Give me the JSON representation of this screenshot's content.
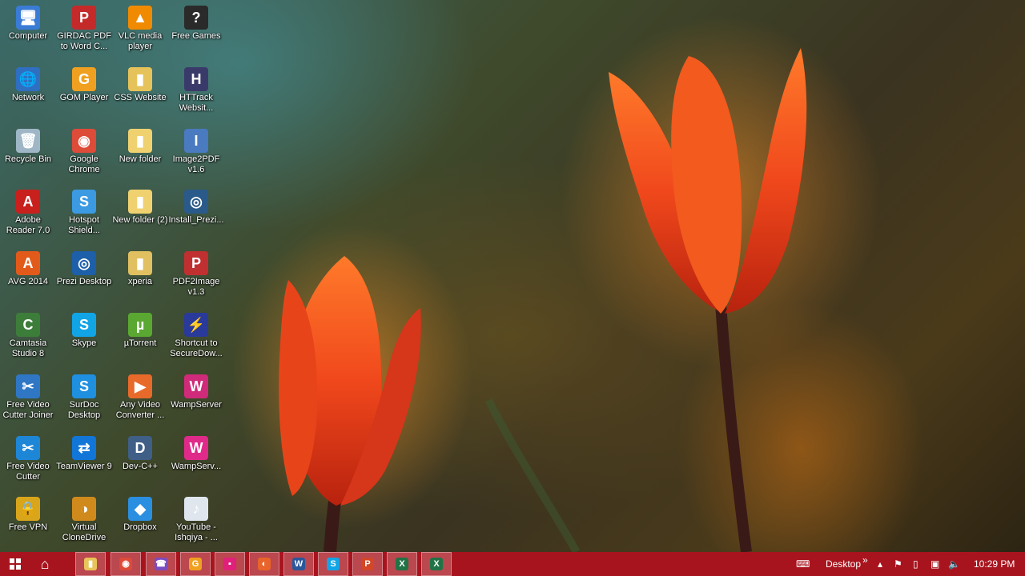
{
  "desktop": {
    "icons": [
      {
        "label": "Computer",
        "icon": "computer-icon",
        "glyph": "🖥",
        "color": "#3a7bd5"
      },
      {
        "label": "Network",
        "icon": "network-icon",
        "glyph": "🌐",
        "color": "#2f6fc1"
      },
      {
        "label": "Recycle Bin",
        "icon": "recycle-bin-icon",
        "glyph": "🗑",
        "color": "#9fb6c6"
      },
      {
        "label": "Adobe Reader 7.0",
        "icon": "adobe-reader-icon",
        "glyph": "A",
        "color": "#c8201c"
      },
      {
        "label": "AVG 2014",
        "icon": "avg-icon",
        "glyph": "A",
        "color": "#e25a1a"
      },
      {
        "label": "Camtasia Studio 8",
        "icon": "camtasia-icon",
        "glyph": "C",
        "color": "#3d7d3a"
      },
      {
        "label": "Free Video Cutter Joiner",
        "icon": "video-cutter-joiner-icon",
        "glyph": "✂",
        "color": "#2f77c4"
      },
      {
        "label": "Free Video Cutter",
        "icon": "video-cutter-icon",
        "glyph": "✂",
        "color": "#1e86d6"
      },
      {
        "label": "Free VPN",
        "icon": "vpn-lock-icon",
        "glyph": "🔒",
        "color": "#d9a51a"
      },
      {
        "label": "GIRDAC PDF to Word C...",
        "icon": "pdf-converter-icon",
        "glyph": "P",
        "color": "#c42a2a"
      },
      {
        "label": "GOM Player",
        "icon": "gom-player-icon",
        "glyph": "G",
        "color": "#f0a020"
      },
      {
        "label": "Google Chrome",
        "icon": "chrome-icon",
        "glyph": "◉",
        "color": "#dd4b39"
      },
      {
        "label": "Hotspot Shield...",
        "icon": "hotspot-shield-icon",
        "glyph": "S",
        "color": "#3b9ae1"
      },
      {
        "label": "Prezi Desktop",
        "icon": "prezi-icon",
        "glyph": "◎",
        "color": "#1d5fa8"
      },
      {
        "label": "Skype",
        "icon": "skype-icon",
        "glyph": "S",
        "color": "#12a5e6"
      },
      {
        "label": "SurDoc Desktop",
        "icon": "surdoc-icon",
        "glyph": "S",
        "color": "#1f8fe0"
      },
      {
        "label": "TeamViewer 9",
        "icon": "teamviewer-icon",
        "glyph": "⇄",
        "color": "#1176d8"
      },
      {
        "label": "Virtual CloneDrive",
        "icon": "clonedrive-icon",
        "glyph": "◑",
        "color": "#d08a1c"
      },
      {
        "label": "VLC media player",
        "icon": "vlc-icon",
        "glyph": "▲",
        "color": "#f08a00"
      },
      {
        "label": "CSS Website",
        "icon": "folder-icon",
        "glyph": "▮",
        "color": "#e6c35a"
      },
      {
        "label": "New folder",
        "icon": "folder-icon",
        "glyph": "▮",
        "color": "#f0d170"
      },
      {
        "label": "New folder (2)",
        "icon": "folder-icon",
        "glyph": "▮",
        "color": "#f0d170"
      },
      {
        "label": "xperia",
        "icon": "folder-icon",
        "glyph": "▮",
        "color": "#e0c060"
      },
      {
        "label": "µTorrent",
        "icon": "utorrent-icon",
        "glyph": "µ",
        "color": "#5aa832"
      },
      {
        "label": "Any Video Converter ...",
        "icon": "video-converter-icon",
        "glyph": "▶",
        "color": "#e86a2a"
      },
      {
        "label": "Dev-C++",
        "icon": "devcpp-icon",
        "glyph": "D",
        "color": "#3f5f87"
      },
      {
        "label": "Dropbox",
        "icon": "dropbox-icon",
        "glyph": "◆",
        "color": "#2a8fe0"
      },
      {
        "label": "Free Games",
        "icon": "free-games-icon",
        "glyph": "?",
        "color": "#2a2a2a"
      },
      {
        "label": "HTTrack Websit...",
        "icon": "httrack-icon",
        "glyph": "H",
        "color": "#3a3a6a"
      },
      {
        "label": "Image2PDF v1.6",
        "icon": "image2pdf-icon",
        "glyph": "I",
        "color": "#4a7ac0"
      },
      {
        "label": "Install_Prezi...",
        "icon": "prezi-install-icon",
        "glyph": "◎",
        "color": "#2a5a8a"
      },
      {
        "label": "PDF2Image v1.3",
        "icon": "pdf2image-icon",
        "glyph": "P",
        "color": "#c03030"
      },
      {
        "label": "Shortcut to SecureDow...",
        "icon": "securedownload-icon",
        "glyph": "⚡",
        "color": "#2a3a9a"
      },
      {
        "label": "WampServer",
        "icon": "wampserver-icon",
        "glyph": "W",
        "color": "#d02a7a"
      },
      {
        "label": "WampServ...",
        "icon": "wampserver-icon",
        "glyph": "W",
        "color": "#e02a8a"
      },
      {
        "label": "YouTube - Ishqiya - ...",
        "icon": "mp3-file-icon",
        "glyph": "♪",
        "color": "#dfe6ee"
      }
    ]
  },
  "taskbar": {
    "start_icon": "windows-start-icon",
    "pinned": [
      {
        "name": "home-icon",
        "glyph": "⌂",
        "color": "#a8141e"
      },
      {
        "name": "file-explorer-icon",
        "glyph": "▮",
        "color": "#e8c45a"
      },
      {
        "name": "chrome-icon",
        "glyph": "◉",
        "color": "#dd4b39"
      },
      {
        "name": "viber-icon",
        "glyph": "☎",
        "color": "#7a4cc0"
      },
      {
        "name": "gom-player-icon",
        "glyph": "G",
        "color": "#f0a020"
      },
      {
        "name": "app-pink-icon",
        "glyph": "▪",
        "color": "#e0207a"
      },
      {
        "name": "firefox-icon",
        "glyph": "◐",
        "color": "#e8642a"
      },
      {
        "name": "word-icon",
        "glyph": "W",
        "color": "#2b579a"
      },
      {
        "name": "skype-icon",
        "glyph": "S",
        "color": "#12a5e6"
      },
      {
        "name": "powerpoint-icon",
        "glyph": "P",
        "color": "#d24726"
      },
      {
        "name": "excel-icon",
        "glyph": "X",
        "color": "#217346"
      },
      {
        "name": "excel-icon",
        "glyph": "X",
        "color": "#217346"
      }
    ],
    "toolbar_label": "Desktop",
    "toolbar_chevron": "»",
    "clock": "10:29 PM"
  }
}
